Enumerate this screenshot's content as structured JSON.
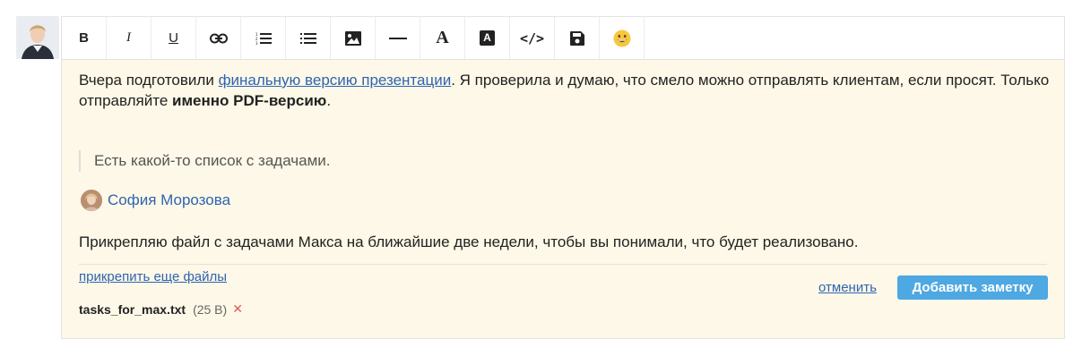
{
  "toolbar": {
    "buttons": [
      {
        "name": "bold-icon",
        "glyph": "B"
      },
      {
        "name": "italic-icon",
        "glyph": "I"
      },
      {
        "name": "underline-icon",
        "glyph": "U"
      },
      {
        "name": "link-icon"
      },
      {
        "name": "ordered-list-icon"
      },
      {
        "name": "unordered-list-icon"
      },
      {
        "name": "image-icon"
      },
      {
        "name": "horizontal-rule-icon"
      },
      {
        "name": "text-color-icon",
        "glyph": "A"
      },
      {
        "name": "background-color-icon",
        "glyph": "A"
      },
      {
        "name": "code-icon",
        "glyph": "</>"
      },
      {
        "name": "save-icon"
      },
      {
        "name": "emoji-icon"
      }
    ]
  },
  "note": {
    "para1_before": "Вчера подготовили ",
    "para1_link": "финальную версию презентации",
    "para1_after": ". Я проверила и думаю, что смело можно отправлять клиентам, если просят. Только отправляйте ",
    "para1_bold": "именно PDF-версию",
    "para1_end": ".",
    "quote": "Есть какой-то список с задачами.",
    "mention_name": "София Морозова",
    "para2": "Прикрепляю файл с задачами Макса на ближайшие две недели, чтобы вы понимали, что будет реализовано."
  },
  "attachments": {
    "attach_more_label": "прикрепить еще файлы",
    "file_name": "tasks_for_max.txt",
    "file_size": "(25 B)",
    "remove_glyph": "✕"
  },
  "actions": {
    "cancel_label": "отменить",
    "submit_label": "Добавить заметку"
  },
  "colors": {
    "link": "#2f64b3",
    "editor_bg": "#fdf8e7",
    "submit_bg": "#4ea8e2",
    "remove": "#e05a5a"
  }
}
